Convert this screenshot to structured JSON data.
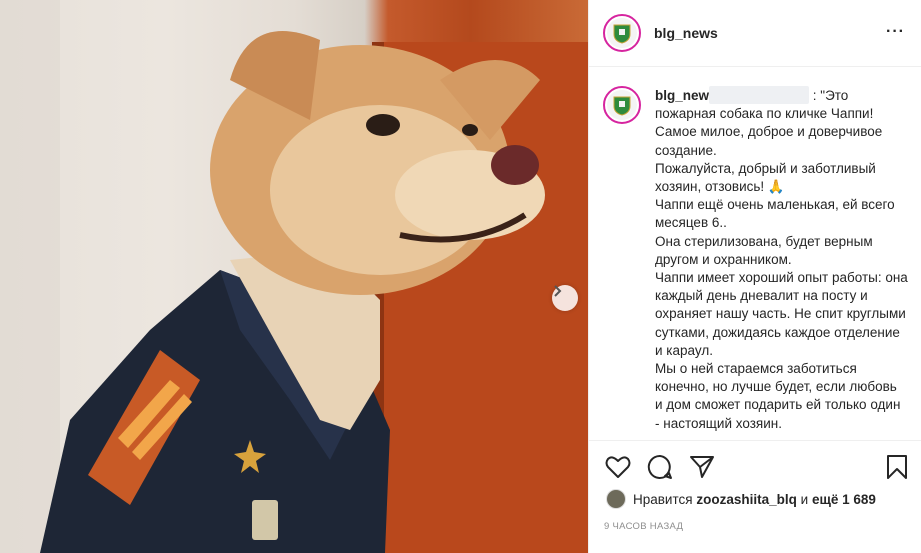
{
  "post": {
    "username": "blg_news",
    "caption_username": "blg_new",
    "caption_lines": [
      ": \"Это пожарная собака по кличке Чаппи! Самое милое, доброе и доверчивое создание.",
      "Пожалуйста, добрый и заботливый хозяин, отзовись! 🙏",
      "Чаппи ещё очень маленькая, ей всего месяцев 6..",
      "Она стерилизована, будет верным другом и охранником.",
      "Чаппи имеет хороший опыт работы: она каждый день дневалит на посту и охраняет нашу часть. Не спит круглыми сутками, дожидаясь каждое отделение и караул.",
      "Мы о ней стараемся заботиться конечно, но лучше будет, если любовь и дом сможет подарить ей только один - настоящий хозяин."
    ],
    "likes_prefix": "Нравится",
    "likes_user": "zoozashiita_blq",
    "likes_middle": "и",
    "likes_rest": "ещё 1 689",
    "timestamp": "9 часов назад"
  },
  "icons": {
    "like": "heart-icon",
    "comment": "comment-icon",
    "share": "share-icon",
    "save": "bookmark-icon",
    "next": "chevron-right-icon",
    "more": "more-options-icon"
  },
  "colors": {
    "story_ring": "#d6249f",
    "text": "#262626",
    "muted": "#8e8e8e"
  }
}
